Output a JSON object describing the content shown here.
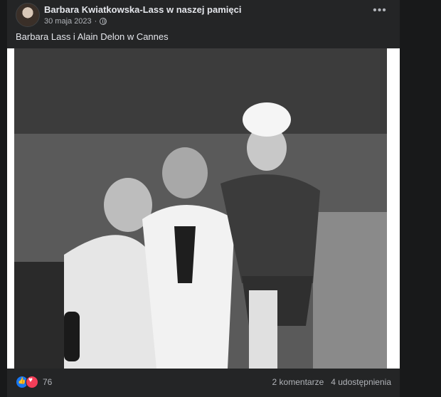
{
  "post": {
    "page_name": "Barbara Kwiatkowska-Lass w naszej pamięci",
    "date": "30 maja 2023",
    "separator": "·",
    "more_label": "•••",
    "caption": "Barbara Lass i Alain Delon w Cannes"
  },
  "footer": {
    "reaction_count": "76",
    "comments": "2 komentarze",
    "shares": "4 udostępnienia"
  },
  "icons": {
    "reactions": [
      "like-icon",
      "love-icon"
    ],
    "privacy": "globe-icon"
  },
  "colors": {
    "background": "#18191a",
    "card": "#242526",
    "text": "#e4e6eb",
    "muted": "#b0b3b8",
    "like": "#1877f2",
    "love": "#f33e58"
  }
}
